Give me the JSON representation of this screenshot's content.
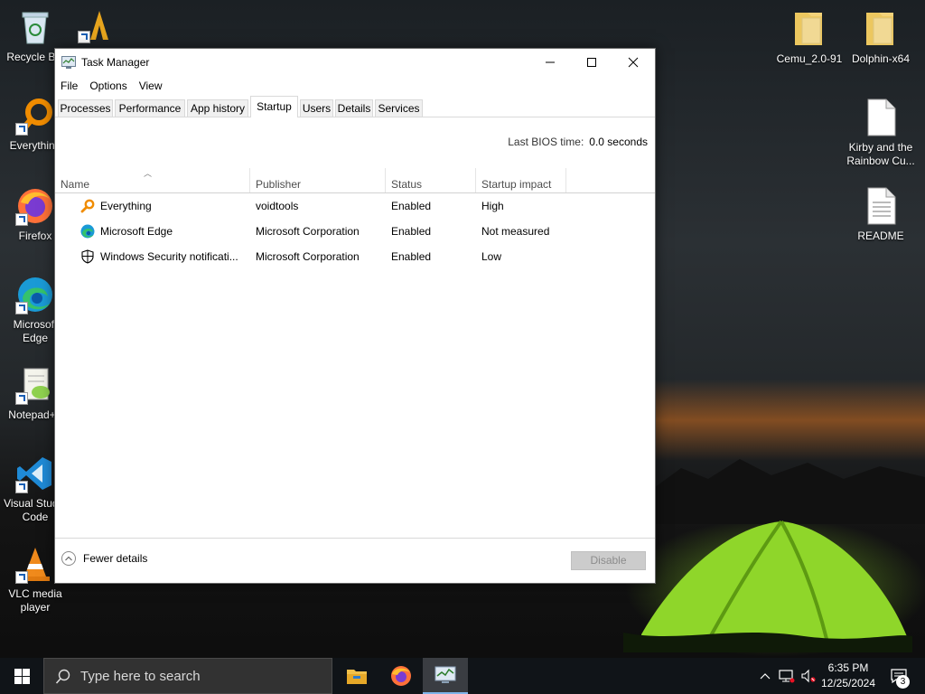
{
  "desktop": {
    "left_icons": [
      {
        "label": "Recycle Bin",
        "icon": "recycle-bin-icon"
      },
      {
        "label": "Everything",
        "icon": "everything-icon"
      },
      {
        "label": "Firefox",
        "icon": "firefox-icon"
      },
      {
        "label": "Microsoft Edge",
        "icon": "edge-icon"
      },
      {
        "label": "Notepad++",
        "icon": "notepadpp-icon"
      },
      {
        "label": "Visual Studio Code",
        "icon": "vscode-icon"
      },
      {
        "label": "VLC media player",
        "icon": "vlc-icon"
      }
    ],
    "right_icons": [
      {
        "label": "Cemu_2.0-91",
        "icon": "folder-icon"
      },
      {
        "label": "Dolphin-x64",
        "icon": "folder-icon"
      },
      {
        "label": "Kirby and the Rainbow Cu...",
        "icon": "file-icon"
      },
      {
        "label": "README",
        "icon": "text-file-icon"
      }
    ]
  },
  "window": {
    "title": "Task Manager",
    "menu": [
      "File",
      "Options",
      "View"
    ],
    "tabs": [
      "Processes",
      "Performance",
      "App history",
      "Startup",
      "Users",
      "Details",
      "Services"
    ],
    "active_tab": "Startup",
    "bios_label": "Last BIOS time:",
    "bios_value": "0.0 seconds",
    "columns": [
      "Name",
      "Publisher",
      "Status",
      "Startup impact"
    ],
    "rows": [
      {
        "name": "Everything",
        "publisher": "voidtools",
        "status": "Enabled",
        "impact": "High",
        "icon": "everything-icon"
      },
      {
        "name": "Microsoft Edge",
        "publisher": "Microsoft Corporation",
        "status": "Enabled",
        "impact": "Not measured",
        "icon": "edge-icon"
      },
      {
        "name": "Windows Security notificati...",
        "publisher": "Microsoft Corporation",
        "status": "Enabled",
        "impact": "Low",
        "icon": "shield-icon"
      }
    ],
    "fewer_details": "Fewer details",
    "disable_button": "Disable"
  },
  "taskbar": {
    "search_placeholder": "Type here to search",
    "time": "6:35 PM",
    "date": "12/25/2024",
    "notification_count": "3"
  },
  "colors": {
    "window_bg": "#ffffff",
    "taskbar_bg": "#101418",
    "accent": "#0078d7",
    "tent_green": "#8fd62a"
  }
}
